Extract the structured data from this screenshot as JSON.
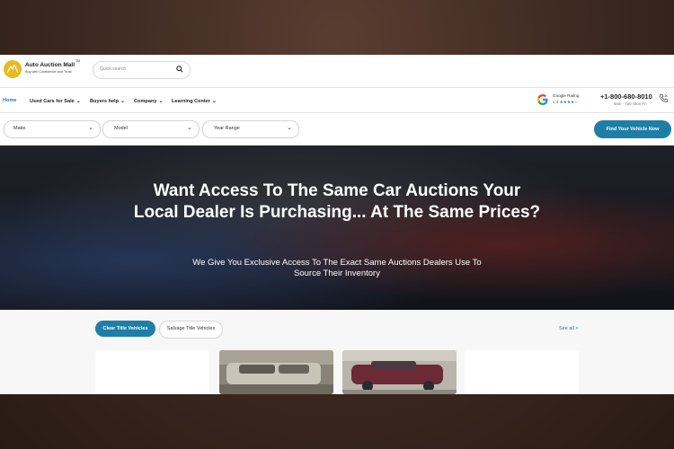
{
  "brand": {
    "name": "Auto Auction Mall",
    "tagline": "Buy with Confidence and Trust",
    "trademark": "TM",
    "logo_color": "#e8b923"
  },
  "search": {
    "placeholder": "Quick search",
    "icon": "search-icon"
  },
  "nav": {
    "items": [
      {
        "label": "Home",
        "active": true,
        "has_dropdown": false
      },
      {
        "label": "Used Cars for Sale",
        "active": false,
        "has_dropdown": true
      },
      {
        "label": "Buyers help",
        "active": false,
        "has_dropdown": true
      },
      {
        "label": "Company",
        "active": false,
        "has_dropdown": true
      },
      {
        "label": "Learning Center",
        "active": false,
        "has_dropdown": true
      }
    ],
    "chevron": "⌄"
  },
  "google": {
    "title": "Google Rating",
    "rating": "4.4 ★★★★☆"
  },
  "contact": {
    "phone": "+1-800-680-8010",
    "hours": "9am - 7pm Mon-Fri"
  },
  "filters": {
    "make": "Make",
    "model": "Model",
    "year": "Year Range",
    "chevron": "⌄",
    "button": "Find Your Vehicle Now"
  },
  "hero": {
    "title": "Want Access To The Same Car Auctions Your Local Dealer Is Purchasing... At The Same Prices?",
    "subtitle": "We Give You Exclusive Access To The Exact Same Auctions Dealers Use To Source Their Inventory"
  },
  "listings": {
    "tabs": [
      "Clear Title Vehicles",
      "Salvage Title Vehicles"
    ],
    "see_all": "See all >"
  },
  "colors": {
    "accent": "#1f7ea6",
    "brand_yellow": "#e8b923"
  }
}
